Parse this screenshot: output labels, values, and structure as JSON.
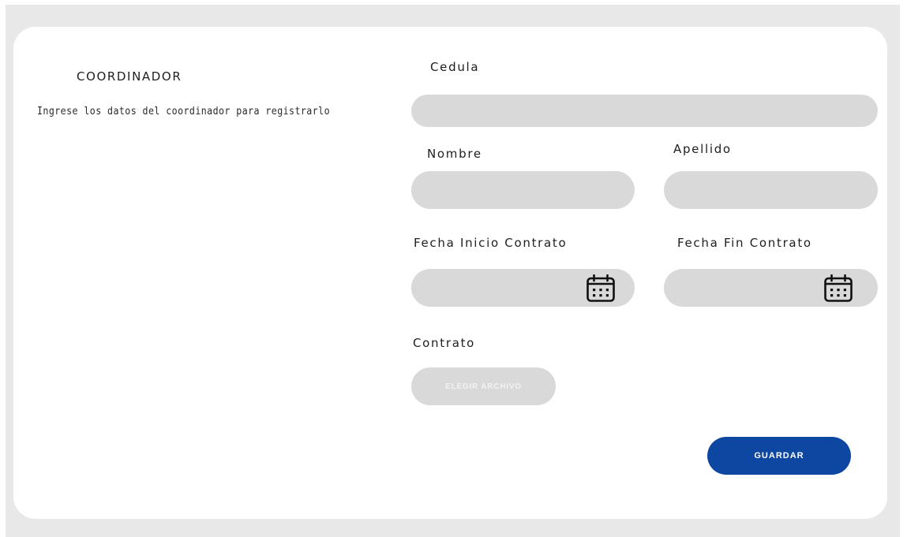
{
  "panel": {
    "title": "COORDINADOR",
    "subtitle": "Ingrese los datos del coordinador para registrarlo"
  },
  "form": {
    "cedula_label": "Cedula",
    "cedula_value": "",
    "nombre_label": "Nombre",
    "nombre_value": "",
    "apellido_label": "Apellido",
    "apellido_value": "",
    "fecha_inicio_label": "Fecha Inicio Contrato",
    "fecha_inicio_value": "",
    "fecha_fin_label": "Fecha Fin Contrato",
    "fecha_fin_value": "",
    "contrato_label": "Contrato",
    "choose_file_label": "ELEGIR ARCHIVO",
    "save_label": "GUARDAR"
  },
  "icons": {
    "date_icon": "calendar-icon"
  },
  "colors": {
    "background": "#e8e8e8",
    "card": "#ffffff",
    "field": "#d9d9d9",
    "primary": "#0d47a1"
  }
}
